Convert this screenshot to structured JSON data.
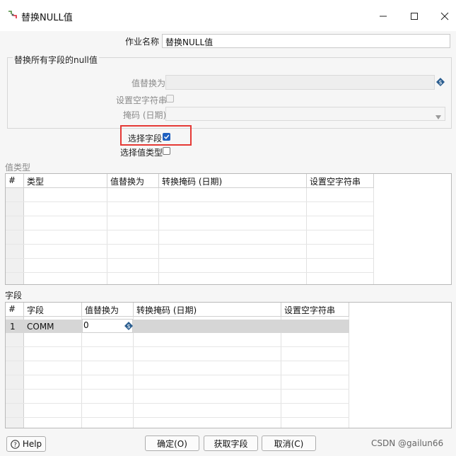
{
  "window": {
    "title": "替换NULL值"
  },
  "job": {
    "label": "作业名称",
    "value": "替换NULL值"
  },
  "group_all": {
    "title": "替换所有字段的null值",
    "replace_label": "值替换为",
    "empty_string_label": "设置空字符串",
    "mask_label": "掩码 (日期)"
  },
  "select_field": {
    "label": "选择字段",
    "checked": true
  },
  "select_value_type": {
    "label": "选择值类型",
    "checked": false
  },
  "value_types": {
    "title": "值类型",
    "columns": [
      "#",
      "类型",
      "值替换为",
      "转换掩码 (日期)",
      "设置空字符串"
    ]
  },
  "fields": {
    "title": "字段",
    "columns": [
      "#",
      "字段",
      "值替换为",
      "转换掩码 (日期)",
      "设置空字符串"
    ],
    "rows": [
      {
        "num": "1",
        "field": "COMM",
        "replace": "0",
        "mask": "",
        "empty": ""
      }
    ]
  },
  "buttons": {
    "help": "Help",
    "ok": "确定(O)",
    "get_fields": "获取字段",
    "cancel": "取消(C)"
  },
  "watermark": "CSDN @gailun66",
  "colors": {
    "highlight_box": "#e53935",
    "checkbox_checked": "#1f5fbf",
    "selected_row": "#d6d6d6"
  }
}
